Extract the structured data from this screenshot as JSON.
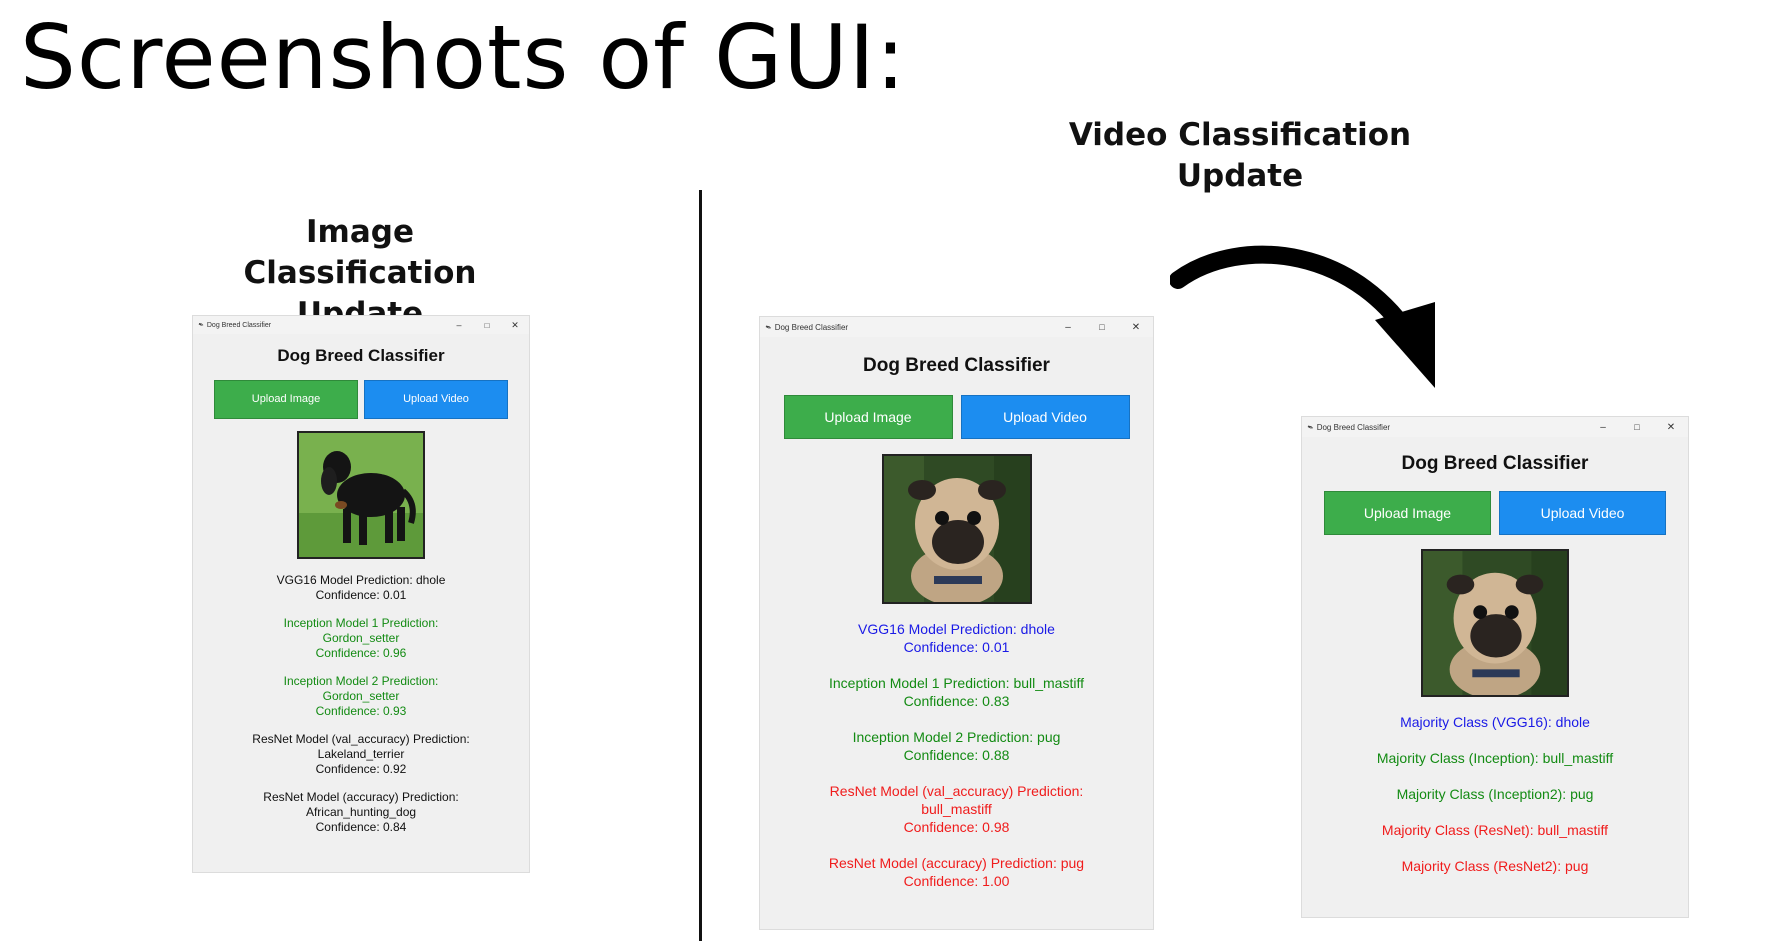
{
  "page": {
    "title": "Screenshots of GUI:",
    "image_section_title": [
      "Image Classification",
      "Update"
    ],
    "video_section_title": [
      "Video Classification",
      "Update"
    ]
  },
  "window1": {
    "window_title": "Dog Breed Classifier",
    "app_title": "Dog Breed Classifier",
    "upload_image_label": "Upload Image",
    "upload_video_label": "Upload Video",
    "predictions": [
      {
        "lines": [
          "VGG16 Model Prediction: dhole",
          "Confidence: 0.01"
        ],
        "color": "#111111"
      },
      {
        "lines": [
          "Inception Model 1 Prediction:",
          "Gordon_setter",
          "Confidence: 0.96"
        ],
        "color": "#138b13"
      },
      {
        "lines": [
          "Inception Model 2 Prediction:",
          "Gordon_setter",
          "Confidence: 0.93"
        ],
        "color": "#138b13"
      },
      {
        "lines": [
          "ResNet Model (val_accuracy) Prediction:",
          "Lakeland_terrier",
          "Confidence: 0.92"
        ],
        "color": "#111111"
      },
      {
        "lines": [
          "ResNet Model (accuracy) Prediction:",
          "African_hunting_dog",
          "Confidence: 0.84"
        ],
        "color": "#111111"
      }
    ]
  },
  "window2": {
    "window_title": "Dog Breed Classifier",
    "app_title": "Dog Breed Classifier",
    "upload_image_label": "Upload Image",
    "upload_video_label": "Upload Video",
    "predictions": [
      {
        "lines": [
          "VGG16 Model Prediction: dhole",
          "Confidence: 0.01"
        ],
        "color": "#1a1ae6"
      },
      {
        "lines": [
          "Inception Model 1 Prediction: bull_mastiff",
          "Confidence: 0.83"
        ],
        "color": "#138b13"
      },
      {
        "lines": [
          "Inception Model 2 Prediction: pug",
          "Confidence: 0.88"
        ],
        "color": "#138b13"
      },
      {
        "lines": [
          "ResNet Model (val_accuracy) Prediction:",
          "bull_mastiff",
          "Confidence: 0.98"
        ],
        "color": "#f01c1c"
      },
      {
        "lines": [
          "ResNet Model (accuracy) Prediction: pug",
          "Confidence: 1.00"
        ],
        "color": "#f01c1c"
      }
    ]
  },
  "window3": {
    "window_title": "Dog Breed Classifier",
    "app_title": "Dog Breed Classifier",
    "upload_image_label": "Upload Image",
    "upload_video_label": "Upload Video",
    "predictions": [
      {
        "lines": [
          "Majority Class (VGG16): dhole"
        ],
        "color": "#1a1ae6"
      },
      {
        "lines": [
          "Majority Class (Inception): bull_mastiff"
        ],
        "color": "#138b13"
      },
      {
        "lines": [
          "Majority Class (Inception2): pug"
        ],
        "color": "#138b13"
      },
      {
        "lines": [
          "Majority Class (ResNet): bull_mastiff"
        ],
        "color": "#f01c1c"
      },
      {
        "lines": [
          "Majority Class (ResNet2): pug"
        ],
        "color": "#f01c1c"
      }
    ]
  },
  "icons": {
    "window_icon": "feather-icon",
    "minimize": "minimize-icon",
    "maximize": "maximize-icon",
    "close": "close-icon",
    "arrow": "curved-arrow-icon"
  },
  "colors": {
    "green_button": "#3dad4b",
    "blue_button": "#1c8df0",
    "window_bg": "#f0f0f0"
  }
}
